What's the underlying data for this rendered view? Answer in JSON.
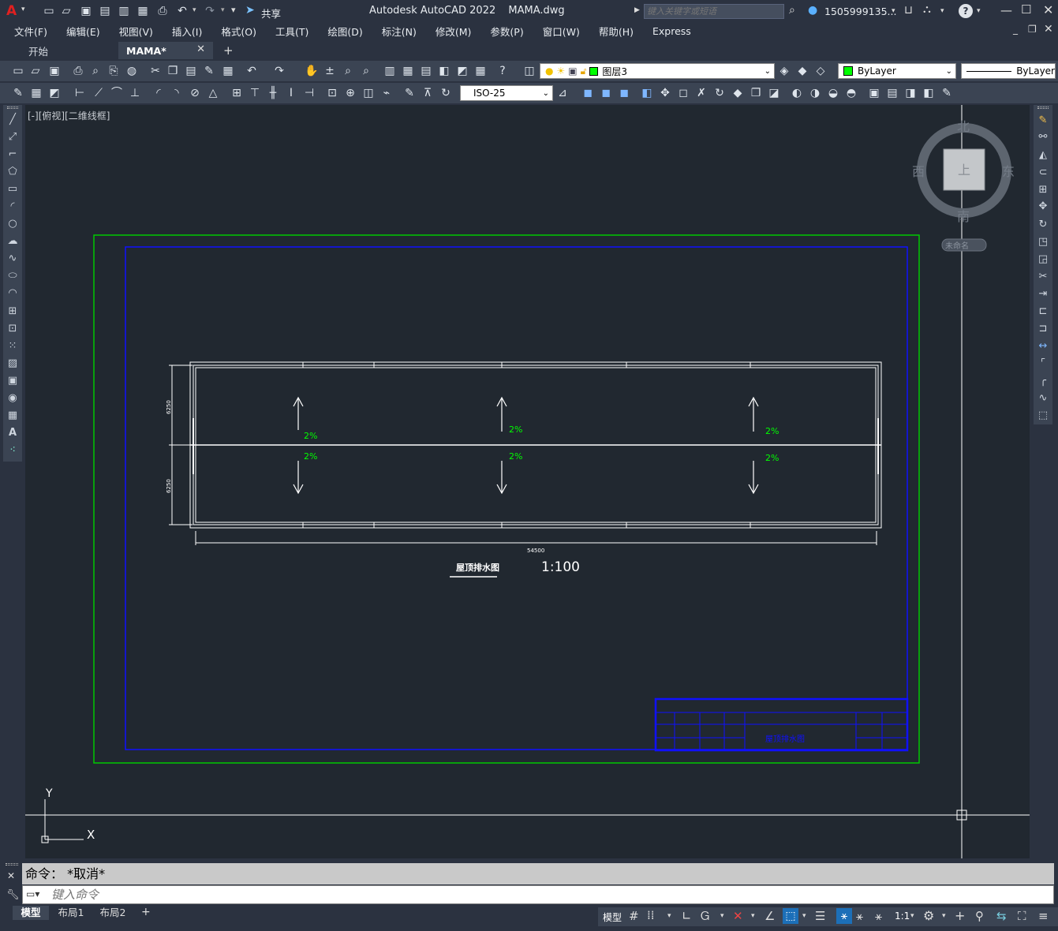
{
  "title_bar": {
    "app_title": "Autodesk AutoCAD 2022",
    "file_name": "MAMA.dwg",
    "share_label": "共享",
    "search_placeholder": "键入关键字或短语",
    "user_name": "1505999135...",
    "help_symbol": "?"
  },
  "menu": {
    "items": [
      "文件(F)",
      "编辑(E)",
      "视图(V)",
      "插入(I)",
      "格式(O)",
      "工具(T)",
      "绘图(D)",
      "标注(N)",
      "修改(M)",
      "参数(P)",
      "窗口(W)",
      "帮助(H)",
      "Express"
    ]
  },
  "tabs": [
    {
      "label": "开始"
    },
    {
      "label": "MAMA*"
    }
  ],
  "toolbar": {
    "layer_value": "图层3",
    "color_value": "ByLayer",
    "linetype_value": "ByLayer",
    "dimstyle_value": "ISO-25"
  },
  "viewport": {
    "label": "[-][俯视][二维线框]"
  },
  "viewcube": {
    "north": "北",
    "south": "南",
    "east": "东",
    "west": "西",
    "top_face": "上",
    "ucs_label": "未命名"
  },
  "drawing": {
    "slope_labels": [
      "2%",
      "2%",
      "2%",
      "2%",
      "2%",
      "2%"
    ],
    "dim_length": "54500",
    "dim_height_top": "6250",
    "dim_height_bottom": "6250",
    "title": "屋顶排水图",
    "scale": "1:100",
    "title_block_text": "屋顶排水图"
  },
  "ucs": {
    "x_label": "X",
    "y_label": "Y"
  },
  "command": {
    "history": "命令：  *取消*",
    "input_placeholder": "键入命令"
  },
  "status": {
    "layout_tabs": [
      "模型",
      "布局1",
      "布局2"
    ],
    "model_label": "模型",
    "scale_label": "1:1"
  },
  "colors": {
    "canvas": "#212830",
    "green_frame": "#00c800",
    "blue_frame": "#0000ff",
    "slope_text": "#00ff00",
    "chrome": "#2b3240",
    "toolbar": "#3b4453"
  }
}
